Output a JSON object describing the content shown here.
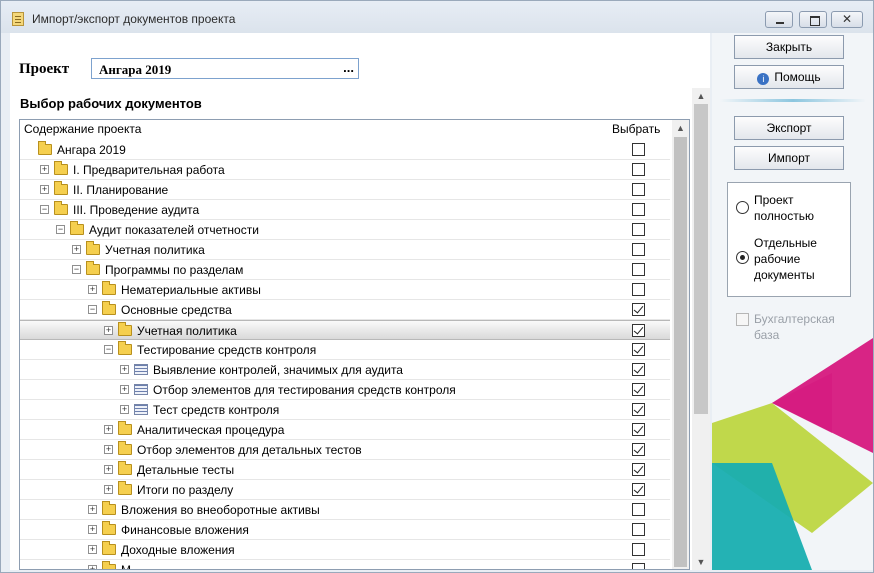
{
  "window": {
    "title": "Импорт/экспорт документов проекта"
  },
  "project": {
    "label": "Проект",
    "value": "Ангара 2019",
    "browse": "..."
  },
  "section_title": "Выбор рабочих документов",
  "tree": {
    "col_content": "Содержание проекта",
    "col_select": "Выбрать",
    "rows": [
      {
        "level": 0,
        "icon": "folder-icon",
        "label": "Ангара 2019",
        "expander": "none",
        "checked": false
      },
      {
        "level": 1,
        "icon": "folder-icon",
        "label": "I. Предварительная работа",
        "expander": "plus",
        "checked": false
      },
      {
        "level": 1,
        "icon": "folder-icon",
        "label": "II. Планирование",
        "expander": "plus",
        "checked": false
      },
      {
        "level": 1,
        "icon": "folder-icon",
        "label": "III. Проведение аудита",
        "expander": "minus",
        "checked": false
      },
      {
        "level": 2,
        "icon": "folder-icon",
        "label": "Аудит показателей отчетности",
        "expander": "minus",
        "checked": false
      },
      {
        "level": 3,
        "icon": "folder-icon",
        "label": "Учетная политика",
        "expander": "plus",
        "checked": false
      },
      {
        "level": 3,
        "icon": "folder-icon",
        "label": "Программы по разделам",
        "expander": "minus",
        "checked": false
      },
      {
        "level": 4,
        "icon": "folder-icon",
        "label": "Нематериальные активы",
        "expander": "plus",
        "checked": false
      },
      {
        "level": 4,
        "icon": "folder-icon",
        "label": "Основные средства",
        "expander": "minus",
        "checked": true
      },
      {
        "level": 5,
        "icon": "folder-icon",
        "label": "Учетная политика",
        "expander": "plus",
        "checked": true,
        "selected": true
      },
      {
        "level": 5,
        "icon": "folder-icon",
        "label": "Тестирование средств контроля",
        "expander": "minus",
        "checked": true
      },
      {
        "level": 6,
        "icon": "document-icon",
        "label": "Выявление контролей, значимых для аудита",
        "expander": "plus",
        "checked": true
      },
      {
        "level": 6,
        "icon": "document-icon",
        "label": "Отбор элементов для тестирования средств контроля",
        "expander": "plus",
        "checked": true
      },
      {
        "level": 6,
        "icon": "document-icon",
        "label": "Тест средств контроля",
        "expander": "plus",
        "checked": true
      },
      {
        "level": 5,
        "icon": "folder-icon",
        "label": "Аналитическая процедура",
        "expander": "plus",
        "checked": true
      },
      {
        "level": 5,
        "icon": "folder-icon",
        "label": "Отбор элементов для детальных тестов",
        "expander": "plus",
        "checked": true
      },
      {
        "level": 5,
        "icon": "folder-icon",
        "label": "Детальные тесты",
        "expander": "plus",
        "checked": true
      },
      {
        "level": 5,
        "icon": "folder-icon",
        "label": "Итоги по разделу",
        "expander": "plus",
        "checked": true
      },
      {
        "level": 4,
        "icon": "folder-icon",
        "label": "Вложения во внеоборотные активы",
        "expander": "plus",
        "checked": false
      },
      {
        "level": 4,
        "icon": "folder-icon",
        "label": "Финансовые вложения",
        "expander": "plus",
        "checked": false
      },
      {
        "level": 4,
        "icon": "folder-icon",
        "label": "Доходные вложения",
        "expander": "plus",
        "checked": false
      },
      {
        "level": 4,
        "icon": "folder-icon",
        "label": "М",
        "expander": "plus",
        "checked": false
      }
    ]
  },
  "sidebar": {
    "close_label": "Закрыть",
    "help_label": "Помощь",
    "export_label": "Экспорт",
    "import_label": "Импорт",
    "radio_whole_label": "Проект полностью",
    "radio_docs_label": "Отдельные рабочие документы",
    "selected_mode": "docs",
    "buh_label": "Бухгалтерская база",
    "buh_enabled": false
  },
  "colors": {
    "accent_magenta": "#d6187e",
    "accent_lime": "#b7d22d",
    "accent_teal": "#18aeb0"
  }
}
